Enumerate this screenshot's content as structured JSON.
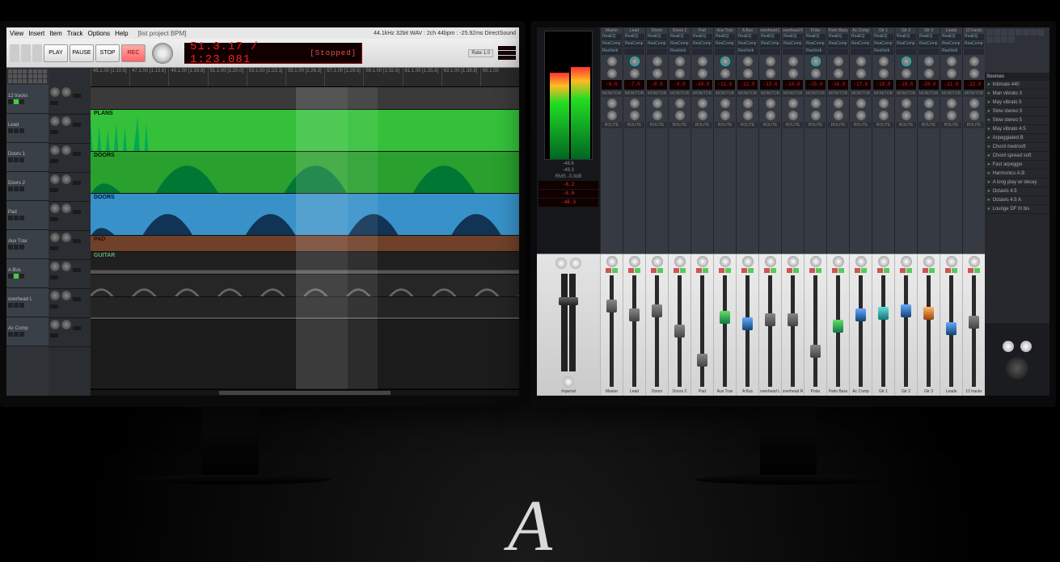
{
  "menubar": [
    "View",
    "Insert",
    "Item",
    "Track",
    "Options",
    "Help",
    "[list project BPM]"
  ],
  "transport": {
    "play": "PLAY",
    "pause": "PAUSE",
    "stop": "STOP",
    "rec": "REC"
  },
  "timecode": {
    "main": "51.3.17 / 1:23.081",
    "status": "[Stopped]"
  },
  "status_line": "44.1kHz 32bit WAV : 2ch 44bpm : -25.92ms DirectSound",
  "ruler": [
    "45.1.00\n[1:10.5]",
    "47.1.00\n[1:13.6]",
    "49.1.00\n[1:16.8]",
    "51.1.00\n[1:20.0]",
    "53.1.00\n[1:23.1]",
    "55.1.00\n[1:26.3]",
    "57.1.00\n[1:29.5]",
    "59.1.00\n[1:32.6]",
    "61.1.00\n[1:35.8]",
    "63.1.00\n[1:38.9]",
    "65.1.00"
  ],
  "tracks_left": [
    {
      "name": "12 tracks"
    },
    {
      "name": "Lead"
    },
    {
      "name": "Doors 1"
    },
    {
      "name": "Doors 2"
    },
    {
      "name": "Pad"
    },
    {
      "name": "Aux Trax"
    },
    {
      "name": "A Bus"
    },
    {
      "name": "overhead L"
    },
    {
      "name": "Ac Comp"
    }
  ],
  "clips": [
    {
      "label": "",
      "color": "#555"
    },
    {
      "label": "PLANS",
      "color": "#35c03a"
    },
    {
      "label": "DOORS",
      "color": "#2aa02e"
    },
    {
      "label": "DOORS",
      "color": "#3892c9"
    },
    {
      "label": "PAD",
      "color": "#70412a"
    },
    {
      "label": "GUITAR",
      "color": "#2a2a2a"
    },
    {
      "label": "",
      "color": "#323232"
    },
    {
      "label": "",
      "color": "#2e2e2e"
    },
    {
      "label": "",
      "color": "#2e2e2e"
    }
  ],
  "mixer": {
    "master_readouts": [
      "-6.2",
      "-6.0",
      "-48.3"
    ],
    "vu_labels": {
      "l": "-48.6",
      "r": "-48.3",
      "mode": "RMS -3.0dB"
    },
    "channels": [
      {
        "name": "Master",
        "color": "grey",
        "pos": 22
      },
      {
        "name": "Lead",
        "color": "grey",
        "pos": 30
      },
      {
        "name": "Doors",
        "color": "grey",
        "pos": 26
      },
      {
        "name": "Doors 2",
        "color": "grey",
        "pos": 44
      },
      {
        "name": "Pad",
        "color": "grey",
        "pos": 70
      },
      {
        "name": "Aux Trax",
        "color": "green",
        "pos": 32
      },
      {
        "name": "A Bus",
        "color": "blue",
        "pos": 38
      },
      {
        "name": "overhead L",
        "color": "grey",
        "pos": 34
      },
      {
        "name": "overhead R",
        "color": "grey",
        "pos": 34
      },
      {
        "name": "Polar",
        "color": "grey",
        "pos": 62
      },
      {
        "name": "Palm Bass",
        "color": "green",
        "pos": 40
      },
      {
        "name": "Ac Comp",
        "color": "blue",
        "pos": 30
      },
      {
        "name": "Gtr 1",
        "color": "cyan",
        "pos": 28
      },
      {
        "name": "Gtr 2",
        "color": "blue",
        "pos": 26
      },
      {
        "name": "Gtr 3",
        "color": "orange",
        "pos": 28
      },
      {
        "name": "Leads",
        "color": "blue",
        "pos": 42
      },
      {
        "name": "12 tracks",
        "color": "grey",
        "pos": 36
      }
    ],
    "fx_labels": [
      "ReaEQ",
      "ReaComp",
      "ReaVerb"
    ],
    "route_label": "ROUTE",
    "monitor_label": "MONITOR",
    "master_brand": "Imperial",
    "side_header": "Sources",
    "side_list": [
      "Intimate 440",
      "Man vibrato 3",
      "May vibrato 5",
      "Slow stereo 3",
      "Slow stereo 5",
      "May vibrato 4.5",
      "Arpeggiated B",
      "Chord med/soft",
      "Chord spread soft",
      "Fast arpeggio",
      "Harmonics A.B",
      "A long play w/ decay",
      "Octavis 4.5",
      "Octavis 4.5 A",
      "Lounge DF III bis"
    ]
  },
  "signature": "A"
}
